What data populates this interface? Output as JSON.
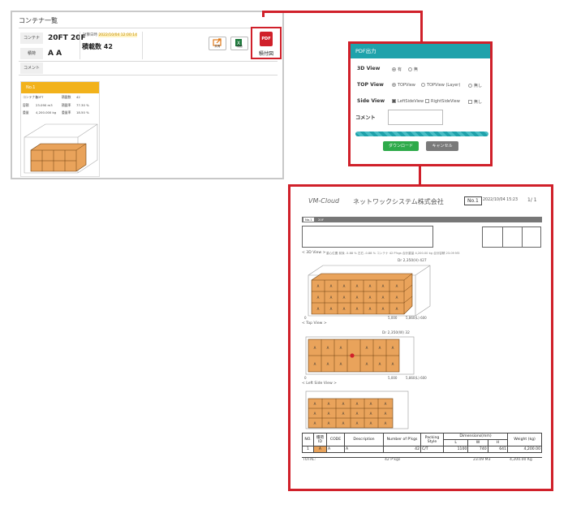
{
  "screen": {
    "title": "コンテナ一覧",
    "labels": {
      "container": "コンテナ",
      "destination": "積荷",
      "comment": "コメント"
    },
    "container_value": "20FT 20F",
    "destination_value": "A A",
    "plan_label": "計算日時",
    "plan_time": "2022/10/04 12:00:14",
    "pieces_label": "積載数 42",
    "buttons": {
      "share": "共有",
      "excel": "明細",
      "pdf": "積付図",
      "pdf_icon": "PDF"
    },
    "card": {
      "badge": "No.1",
      "rows": [
        {
          "k1": "コンテナ名",
          "v1": "20FT",
          "k2": "積載数",
          "v2": "42"
        },
        {
          "k1": "容積",
          "k2": "積載率",
          "v1": "23.090 m3",
          "v2": "77.30 %"
        },
        {
          "k1": "重量",
          "k2": "重量率",
          "v1": "4,200.000 kg",
          "v2": "18.50 %"
        }
      ]
    }
  },
  "dialog": {
    "title": "PDF出力",
    "rows": {
      "view3d": {
        "label": "3D View",
        "options": [
          "有",
          "無"
        ]
      },
      "top": {
        "label": "TOP View",
        "options": [
          "TOPView",
          "TOPView (Layer)",
          "無し"
        ]
      },
      "side": {
        "label": "Side View",
        "options": [
          "LeftSideView",
          "RightSideView",
          "無し"
        ]
      },
      "comment": {
        "label": "コメント"
      }
    },
    "download": "ダウンロード",
    "cancel": "キャンセル",
    "colors": {
      "header": "#1fa2ab",
      "download": "#2eaa4a",
      "cancel": "#7a7a7a",
      "highlight": "#d0202a"
    }
  },
  "doc": {
    "brand": "VM-Cloud",
    "company": "ネットワックシステム株式会社",
    "no_box": "No.1",
    "date": "2022/10/04 15:23",
    "page": "1/ 1",
    "bar_no": "No.1",
    "bar_text": "20F",
    "view3d_title": "< 3D View >",
    "view3d_info": "重心位置  前後 -5.88 %  左右 -0.88 %  コンテナ 42 P'kgs  合計重量 4,200.00 kg  合計容積 23.09 M3",
    "dim3d": "Dr 2,350(H) 427",
    "axis3d": [
      "0",
      "5,000",
      "5,860(L) 600"
    ],
    "top_title": "< Top View >",
    "dimtop": "Dr 2,350(W) 32",
    "axistop": [
      "0",
      "5,000",
      "5,860(L) 600"
    ],
    "side_title": "< Left Side View >",
    "cell_mark": "A",
    "table": {
      "headers": [
        "NO.",
        "積荷 ID",
        "CODE",
        "Description",
        "Number of P'kgs",
        "Packing Style",
        "Dimensions(mm)",
        "Weight (kg)"
      ],
      "dim_sub": [
        "L",
        "W",
        "H"
      ],
      "rows": [
        {
          "no": "1",
          "id": "A",
          "code": "A",
          "desc": "A",
          "num": "42",
          "style": "C/T",
          "l": "1100",
          "w": "740",
          "h": "641",
          "weight": "4,200.00"
        }
      ],
      "total_label": "TOTAL:",
      "total_pkgs": "42 P'kgs",
      "total_vol": "23.09 M3",
      "total_weight": "4,200.00 Kg"
    }
  }
}
